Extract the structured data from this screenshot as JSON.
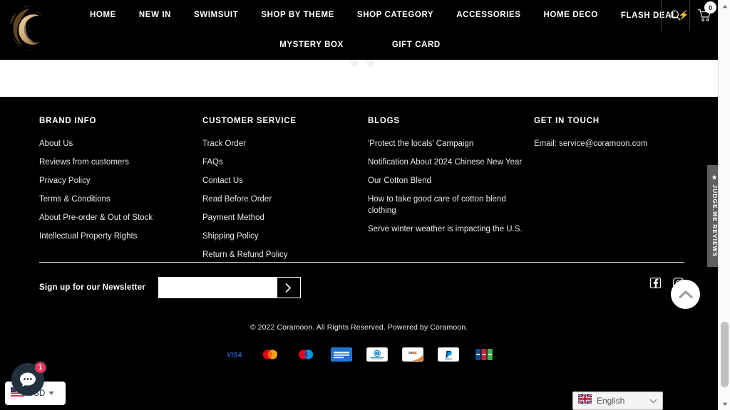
{
  "header": {
    "logo_alt": "Coramoon crescent moon C logo",
    "nav_row1": [
      {
        "label": "HOME"
      },
      {
        "label": "NEW IN"
      },
      {
        "label": "SWIMSUIT"
      },
      {
        "label": "SHOP BY THEME"
      },
      {
        "label": "SHOP CATEGORY"
      },
      {
        "label": "ACCESSORIES"
      },
      {
        "label": "HOME DECO"
      },
      {
        "label": "FLASH DEAL",
        "bolt": "⚡"
      }
    ],
    "nav_row2": [
      {
        "label": "MYSTERY BOX"
      },
      {
        "label": "GIFT CARD"
      }
    ],
    "search_icon": "search-icon",
    "cart_icon": "cart-icon",
    "cart_count": "0"
  },
  "footer": {
    "columns": [
      {
        "title": "BRAND INFO",
        "links": [
          "About Us",
          "Reviews from customers",
          "Privacy Policy",
          "Terms & Conditions",
          "About Pre-order & Out of Stock",
          "Intellectual Property Rights"
        ]
      },
      {
        "title": "CUSTOMER SERVICE",
        "links": [
          "Track Order",
          "FAQs",
          "Contact Us",
          "Read Before Order",
          "Payment Method",
          "Shipping Policy",
          "Return & Refund Policy"
        ]
      },
      {
        "title": "BLOGS",
        "links": [
          "'Protect the locals' Campaign",
          "Notification About 2024 Chinese New Year",
          "Our Cotton Blend",
          "How to take good care of cotton blend clothing",
          "Serve winter weather is impacting the U.S."
        ]
      },
      {
        "title": "GET IN TOUCH",
        "links": [
          "Email: service@coramoon.com"
        ]
      }
    ],
    "newsletter": {
      "label": "Sign up for our Newsletter",
      "input_value": "",
      "input_placeholder": "",
      "submit_label": "›"
    },
    "socials": [
      {
        "name": "facebook-icon"
      },
      {
        "name": "instagram-icon"
      }
    ],
    "copyright": "© 2022 Coramoon. All Rights Reserved. Powered by Coramoon.",
    "payments": [
      {
        "name": "visa",
        "label": "VISA"
      },
      {
        "name": "mastercard",
        "label": "Mastercard"
      },
      {
        "name": "maestro",
        "label": "Maestro"
      },
      {
        "name": "amex",
        "label": "American Express"
      },
      {
        "name": "diners-club",
        "label": "Diners Club"
      },
      {
        "name": "discover",
        "label": "DISCOVER"
      },
      {
        "name": "paypal",
        "label": "PayPal"
      },
      {
        "name": "jcb",
        "label": "JCB"
      }
    ]
  },
  "widgets": {
    "judgeme_tab": "★ JUDGE.ME REVIEWS",
    "scroll_top_icon": "chevron-up-icon",
    "currency": {
      "value": "USD",
      "flag": "us-flag-icon"
    },
    "chat": {
      "badge": "1",
      "icon": "chat-bubble-icon"
    },
    "language": {
      "value": "English",
      "flag": "uk-flag-icon"
    }
  }
}
